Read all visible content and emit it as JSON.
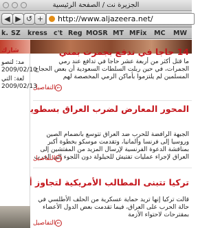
{
  "window": {
    "title": "الجزيرة نت / الصفحة الرئيسية"
  },
  "toolbar": {
    "back": "◀",
    "forward": "▶",
    "reload": "↺",
    "add": "+",
    "url": "http://www.aljazeera.net/"
  },
  "bookmarks": [
    "k.",
    "SZ",
    "kress",
    "c't",
    "Reg",
    "MOSR",
    "MT",
    "MFix",
    "MC",
    "MW"
  ],
  "sidebar": {
    "share": "شارك",
    "lines": [
      "مد: لتصو",
      "2009/02/10",
      "لعة: التي",
      "2009/02/13"
    ]
  },
  "articles": [
    {
      "headline": "14 حاجا في تدفع بجمرت بمني",
      "body": "ما قتل أكثر من أربعة عشر حاجا في تدافع عند رمي الجمرات، في حين ربلت السلطات السعودية أن بعض الحجاج المسلمين لم يلتزموا بأماكن الرمي المخصصة لهم",
      "more": "التفاصيل"
    },
    {
      "headline": "المحور المعارض لضرب العراق بسطويا",
      "body": "الجبهة الرافضة للحرب ضد العراق تتوسع بانضمام الصين وروسيا إلى فرنسا وألمانيا، وتقدمت موسكو بخطوة أكبر بمناقشة الدعوة الفرنسية لإرسال المزيد من المفتشين إلى العراق لإجراء عمليات تفتيش للحيلولة دون اللجوء إلى الحرب",
      "more": "التفاصيل"
    },
    {
      "headline": "تركيا تتبنى المطالب الأمريكية لتجاوز أزمة الناتو",
      "body": "قالت تركيا إنها تريد حماية عسكرية من الحلف الأطلسي في حالة الحرب على العراق، فيما تقدمت بعض الدول الأعضاء بمقترحات لاحتواء الأزمة",
      "more": "التفاصيل"
    }
  ],
  "colors": {
    "accent": "#c4161c",
    "chrome": "#cfcfcf"
  }
}
